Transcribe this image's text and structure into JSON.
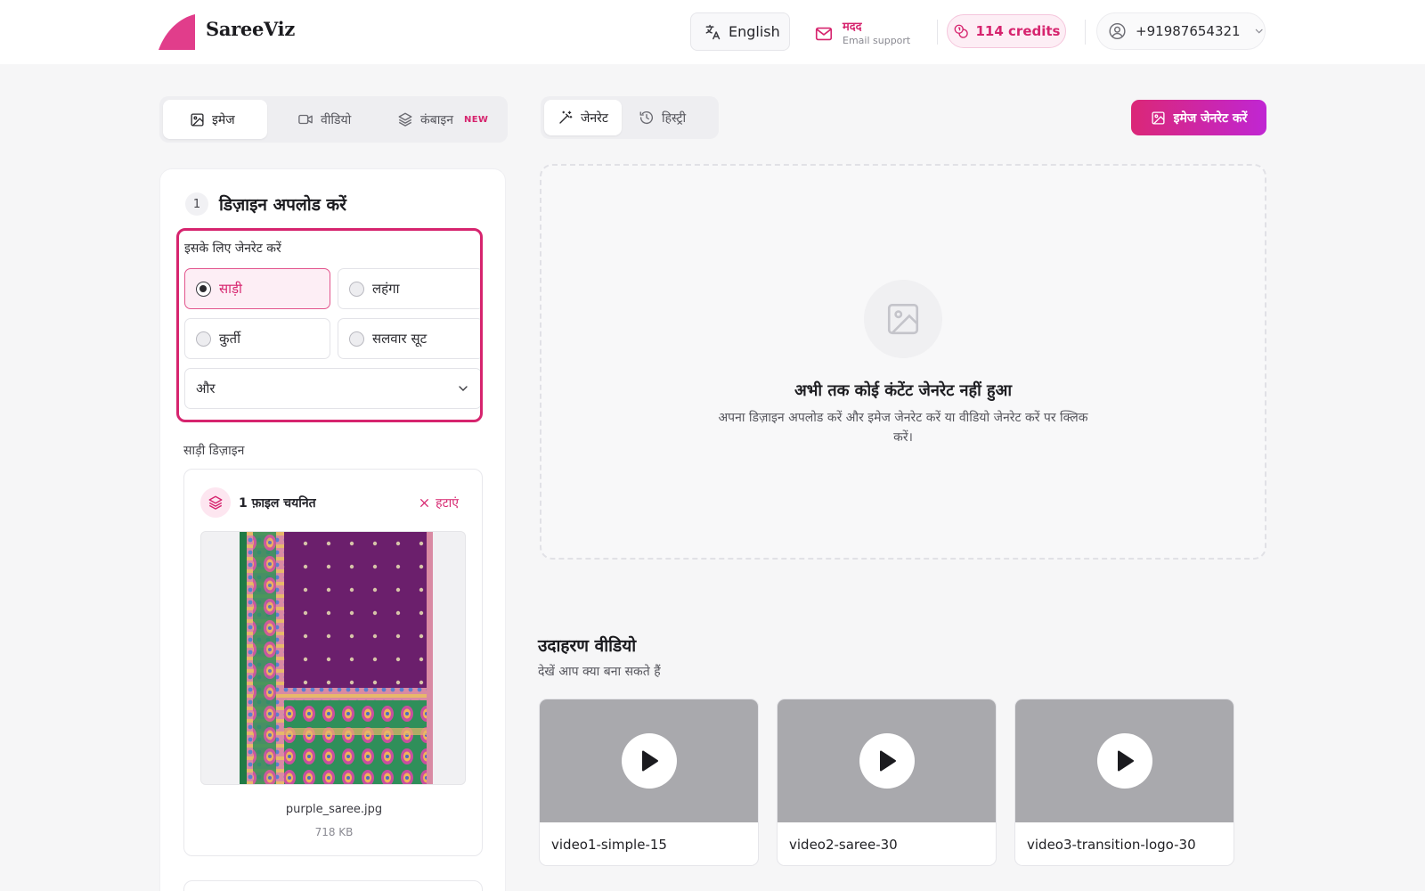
{
  "brand": {
    "name": "SareeViz",
    "accent": "#d6246e",
    "gradient_end": "#c026d3"
  },
  "header": {
    "language_label": "English",
    "help_title": "मदद",
    "help_subtitle": "Email support",
    "credits_label": "114 credits",
    "user_phone": "+91987654321"
  },
  "mode_tabs": [
    {
      "label": "इमेज",
      "icon": "image-icon",
      "active": true
    },
    {
      "label": "वीडियो",
      "icon": "video-icon",
      "active": false
    },
    {
      "label": "कंबाइन",
      "icon": "layers-icon",
      "active": false,
      "badge": "NEW"
    }
  ],
  "gen_tabs": [
    {
      "label": "जेनरेट",
      "icon": "magic-wand-icon",
      "active": true
    },
    {
      "label": "हिस्ट्री",
      "icon": "history-icon",
      "active": false
    }
  ],
  "primary_action": {
    "label": "इमेज जेनरेट करें",
    "icon": "image-icon"
  },
  "upload_section": {
    "step_number": "1",
    "title": "डिज़ाइन अपलोड करें",
    "generate_for_label": "इसके लिए जेनरेट करें",
    "options": [
      {
        "label": "साड़ी",
        "selected": true
      },
      {
        "label": "लहंगा",
        "selected": false
      },
      {
        "label": "कुर्ती",
        "selected": false
      },
      {
        "label": "सलवार सूट",
        "selected": false
      }
    ],
    "more_select_value": "और",
    "design_label": "साड़ी डिज़ाइन",
    "file": {
      "count_label": "1 फ़ाइल चयनित",
      "remove_label": "हटाएं",
      "name": "purple_saree.jpg",
      "size": "718 KB"
    }
  },
  "empty_state": {
    "title": "अभी तक कोई कंटेंट जेनरेट नहीं हुआ",
    "subtitle": "अपना डिज़ाइन अपलोड करें और इमेज जेनरेट करें या वीडियो जेनरेट करें पर क्लिक करें।"
  },
  "examples": {
    "title": "उदाहरण वीडियो",
    "subtitle": "देखें आप क्या बना सकते हैं",
    "videos": [
      {
        "label": "video1-simple-15"
      },
      {
        "label": "video2-saree-30"
      },
      {
        "label": "video3-transition-logo-30"
      }
    ]
  }
}
